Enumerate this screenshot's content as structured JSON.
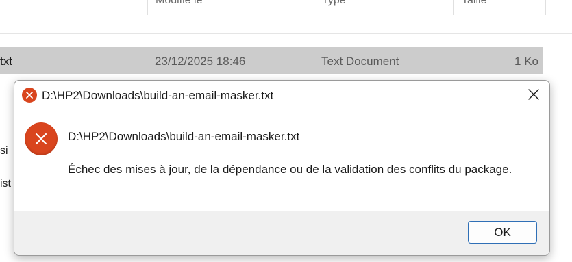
{
  "explorer": {
    "columns": {
      "modified": "Modifié le",
      "type": "Type",
      "size": "Taille"
    },
    "row": {
      "name_fragment": "txt",
      "modified": "23/12/2025 18:46",
      "type": "Text Document",
      "size": "1 Ko"
    },
    "left_fragments": [
      "si",
      "ist"
    ]
  },
  "dialog": {
    "title": "D:\\HP2\\Downloads\\build-an-email-masker.txt",
    "path_text": "D:\\HP2\\Downloads\\build-an-email-masker.txt",
    "message": "Échec des mises à jour, de la dépendance ou de la validation des conflits du package.",
    "ok_label": "OK",
    "icons": {
      "title": "error-icon",
      "close": "close-icon",
      "main": "error-icon"
    },
    "colors": {
      "error_red": "#d9451e",
      "ok_border": "#2f6fb6",
      "footer_bg": "#f0f0f0"
    }
  }
}
